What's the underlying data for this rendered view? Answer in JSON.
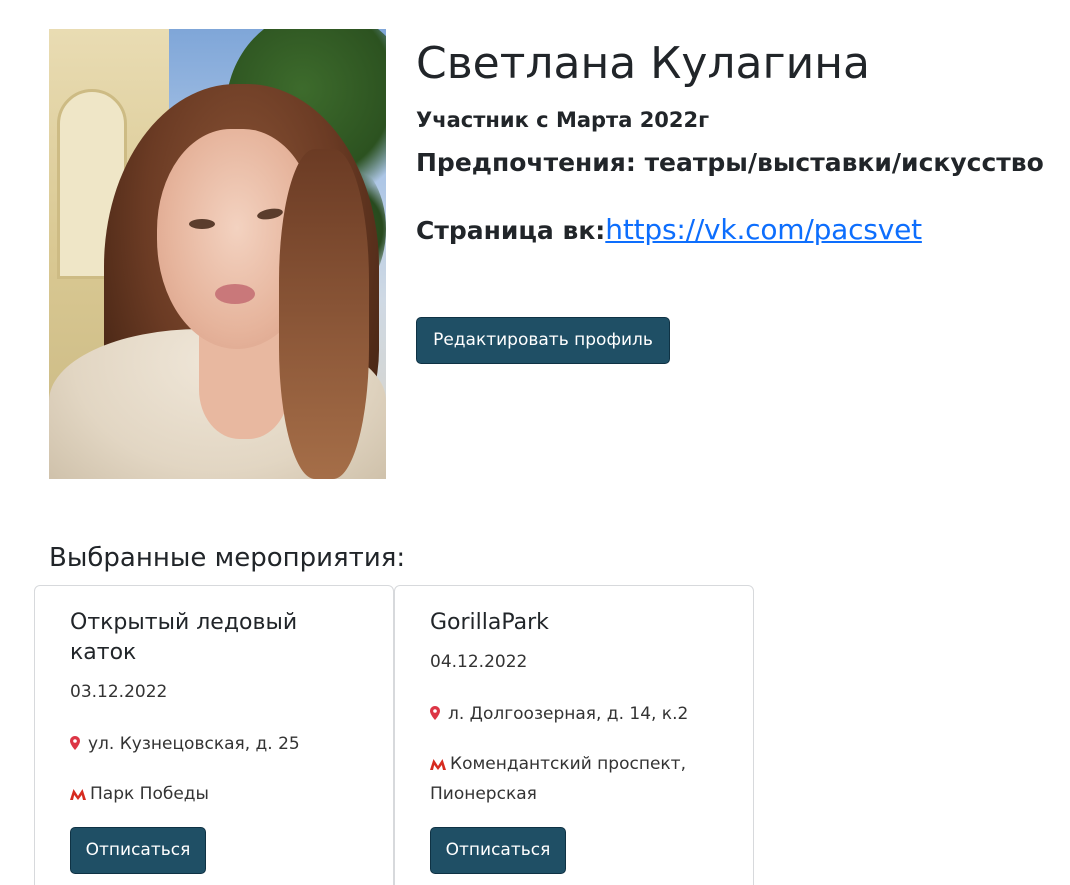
{
  "profile": {
    "name": "Светлана Кулагина",
    "member_since": "Участник с Марта 2022г",
    "preferences": "Предпочтения: театры/выставки/искусство",
    "vk_label": "Страница вк:",
    "vk_link": "https://vk.com/pacsvet",
    "edit_button": "Редактировать профиль"
  },
  "events": {
    "title": "Выбранные мероприятия:",
    "items": [
      {
        "title": "Открытый ледовый каток",
        "date": "03.12.2022",
        "address": "ул. Кузнецовская, д. 25",
        "metro": "Парк Победы",
        "unsubscribe": "Отписаться"
      },
      {
        "title": "GorillaPark",
        "date": "04.12.2022",
        "address": "л. Долгоозерная, д. 14, к.2",
        "metro": "Комендантский проспект, Пионерская",
        "unsubscribe": "Отписаться"
      }
    ]
  },
  "colors": {
    "button_bg": "#1f4f65",
    "link": "#0d6efd",
    "pin": "#dc3545",
    "metro": "#d62b20"
  },
  "icons": [
    "map-pin-icon",
    "metro-icon"
  ]
}
